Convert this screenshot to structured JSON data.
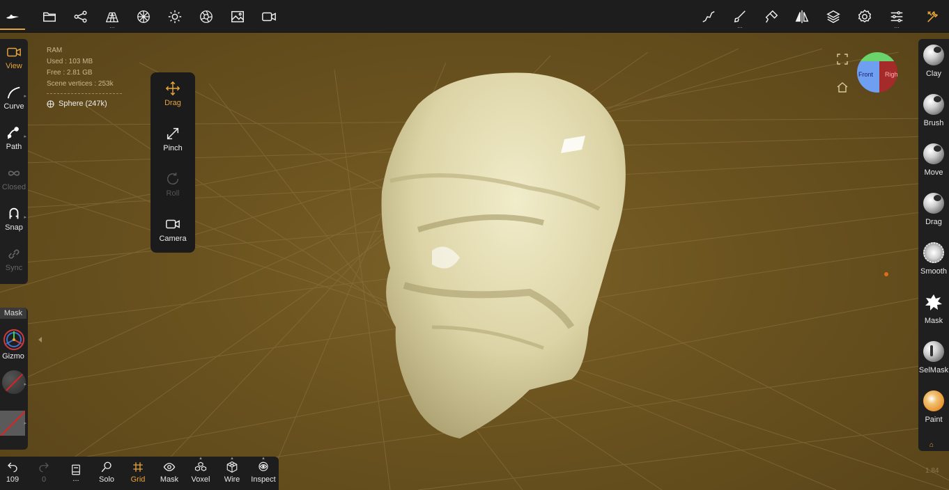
{
  "topbar": {
    "left_icons": [
      "logo-icon",
      "folder-icon",
      "scene-tree-icon",
      "topology-icon",
      "material-sphere-icon",
      "light-icon",
      "camera-settings-icon",
      "image-background-icon",
      "video-camera-icon"
    ],
    "right_icons": [
      "stroke-icon",
      "brush-settings-icon",
      "paint-tool-icon",
      "symmetry-icon",
      "layers-icon",
      "settings-gear-icon",
      "sliders-icon",
      "tools-icon"
    ]
  },
  "left_tools": [
    {
      "name": "View",
      "state": "active"
    },
    {
      "name": "Curve",
      "state": "normal"
    },
    {
      "name": "Path",
      "state": "normal"
    },
    {
      "name": "Closed",
      "state": "disabled"
    },
    {
      "name": "Snap",
      "state": "normal"
    },
    {
      "name": "Sync",
      "state": "disabled"
    }
  ],
  "left_lower": {
    "mask_tab": "Mask",
    "gizmo_label": "Gizmo"
  },
  "stats": {
    "ram": "RAM",
    "used": "Used : 103 MB",
    "free": "Free : 2.81 GB",
    "vertices": "Scene vertices : 253k",
    "object": "Sphere (247k)"
  },
  "drag_popup": [
    {
      "label": "Drag",
      "state": "active"
    },
    {
      "label": "Pinch",
      "state": "normal"
    },
    {
      "label": "Roll",
      "state": "disabled"
    },
    {
      "label": "Camera",
      "state": "normal"
    }
  ],
  "right_brushes": [
    {
      "label": "Clay"
    },
    {
      "label": "Brush"
    },
    {
      "label": "Move"
    },
    {
      "label": "Drag"
    },
    {
      "label": "Smooth"
    },
    {
      "label": "Mask"
    },
    {
      "label": "SelMask"
    },
    {
      "label": "Paint"
    }
  ],
  "bottom": [
    {
      "label": "109",
      "icon": "undo-icon",
      "state": "normal"
    },
    {
      "label": "0",
      "icon": "redo-icon",
      "state": "disabled"
    },
    {
      "label": "...",
      "icon": "notebook-icon",
      "state": "normal"
    },
    {
      "label": "Solo",
      "icon": "search-icon",
      "state": "normal"
    },
    {
      "label": "Grid",
      "icon": "grid-icon",
      "state": "active"
    },
    {
      "label": "Mask",
      "icon": "eye-icon",
      "state": "normal"
    },
    {
      "label": "Voxel",
      "icon": "voxel-icon",
      "state": "normal"
    },
    {
      "label": "Wire",
      "icon": "wireframe-icon",
      "state": "normal"
    },
    {
      "label": "Inspect",
      "icon": "inspect-icon",
      "state": "normal"
    }
  ],
  "view_cube": {
    "front": "Front",
    "right": "Righ"
  },
  "fps": "1.84",
  "colors": {
    "accent": "#e6a43a",
    "viewport": "#6b531f",
    "model": "#e7e1b8",
    "panel": "#1f1f1f"
  }
}
